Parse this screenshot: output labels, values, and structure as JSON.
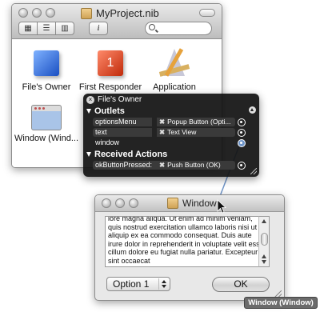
{
  "nib_window": {
    "title": "MyProject.nib",
    "toolbar": {
      "view_buttons": [
        "icon-view-icon",
        "list-view-icon",
        "column-view-icon"
      ],
      "info_label": "i"
    },
    "objects": [
      {
        "label": "File's Owner",
        "icon": "cube-blue-icon"
      },
      {
        "label": "First Responder",
        "icon": "cube-red-icon"
      },
      {
        "label": "Application",
        "icon": "application-icon"
      },
      {
        "label": "Window (Wind...",
        "icon": "window-icon"
      }
    ]
  },
  "connections_panel": {
    "title": "File's Owner",
    "outlets_label": "Outlets",
    "outlets": [
      {
        "name": "optionsMenu",
        "target": "Popup Button (Opti...",
        "connected": true
      },
      {
        "name": "text",
        "target": "Text View",
        "connected": true
      },
      {
        "name": "window",
        "target": "",
        "connected": false
      }
    ],
    "actions_label": "Received Actions",
    "actions": [
      {
        "name": "okButtonPressed:",
        "target": "Push Button (OK)",
        "connected": true
      }
    ]
  },
  "target_window": {
    "title": "Window",
    "text_content": "lore magna aliqua. Ut enim ad minim veniam, quis nostrud exercitation ullamco laboris nisi ut aliquip ex ea commodo consequat. Duis aute irure dolor in reprehenderit in voluptate velit esse cillum dolore eu fugiat nulla pariatur. Excepteur sint occaecat",
    "popup_value": "Option 1",
    "ok_label": "OK"
  },
  "tooltip": "Window (Window)",
  "colors": {
    "hud_bg": "#121212",
    "connect_line": "#6f95c8"
  }
}
